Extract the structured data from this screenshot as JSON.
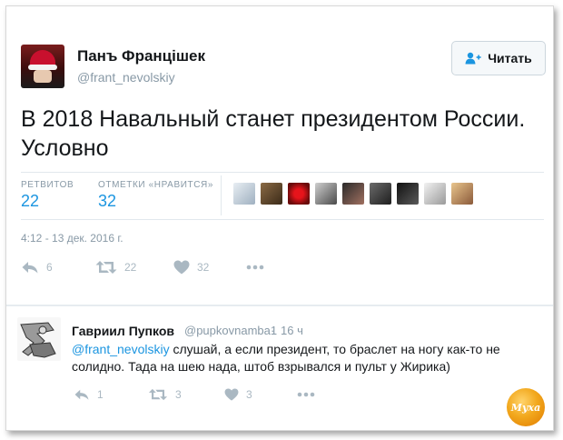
{
  "tweet": {
    "author_name": "Панъ Францішек",
    "author_handle": "@frant_nevolskiy",
    "follow_label": "Читать",
    "text": "В 2018 Навальный станет президентом России. Условно",
    "retweets_label": "РЕТВИТОВ",
    "retweets_count": "22",
    "likes_label": "ОТМЕТКИ «НРАВИТСЯ»",
    "likes_count": "32",
    "timestamp": "4:12 - 13 дек. 2016 г.",
    "actions": {
      "reply_count": "6",
      "retweet_count": "22",
      "like_count": "32"
    }
  },
  "reply": {
    "author_name": "Гавриил Пупков",
    "author_handle": "@pupkovnamba1",
    "separator": "·",
    "time": "16 ч",
    "mention": "@frant_nevolskiy",
    "text": " слушай, а если президент, то браслет на ногу как-то не солидно. Тада на шею нада, штоб взрывался и пульт у Жирика)",
    "actions": {
      "reply_count": "1",
      "retweet_count": "3",
      "like_count": "3"
    }
  },
  "watermark": "Муха",
  "colors": {
    "accent": "#1b95e0",
    "muted": "#8899a6",
    "icon": "#aab8c2",
    "text": "#14171a"
  }
}
